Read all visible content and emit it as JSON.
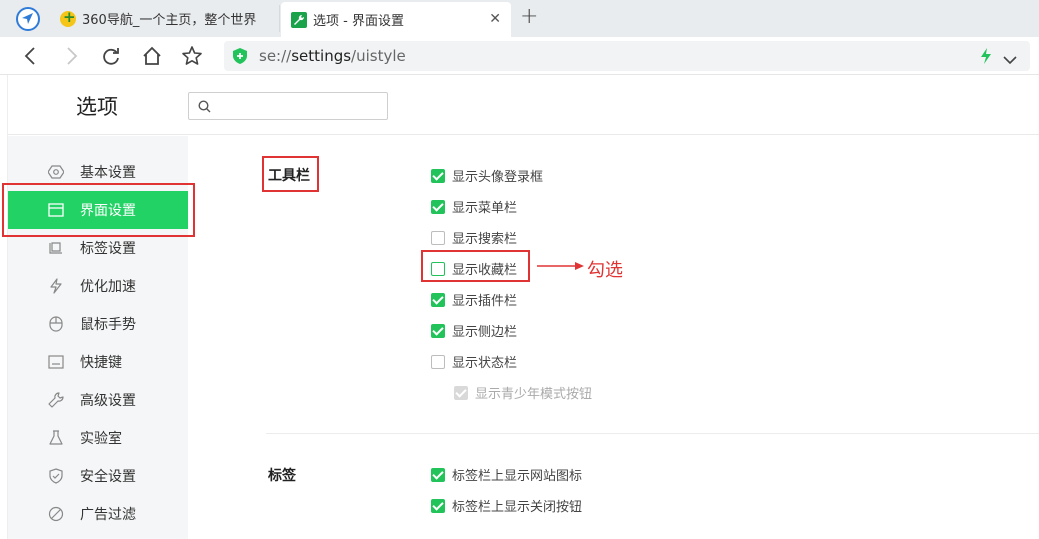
{
  "tabs": [
    {
      "title": "360导航_一个主页，整个世界"
    },
    {
      "title": "选项 - 界面设置"
    }
  ],
  "new_tab_label": "+",
  "close_label": "✕",
  "address": {
    "scheme": "se://",
    "host": "settings",
    "path": "/uistyle"
  },
  "page": {
    "title": "选项",
    "search_placeholder": ""
  },
  "sidebar": {
    "items": [
      {
        "label": "基本设置",
        "icon": "hexagon-icon"
      },
      {
        "label": "界面设置",
        "icon": "window-icon",
        "active": true
      },
      {
        "label": "标签设置",
        "icon": "tab-icon"
      },
      {
        "label": "优化加速",
        "icon": "bolt-icon"
      },
      {
        "label": "鼠标手势",
        "icon": "mouse-icon"
      },
      {
        "label": "快捷键",
        "icon": "keyboard-icon"
      },
      {
        "label": "高级设置",
        "icon": "wrench-icon"
      },
      {
        "label": "实验室",
        "icon": "flask-icon"
      },
      {
        "label": "安全设置",
        "icon": "shield-check-icon"
      },
      {
        "label": "广告过滤",
        "icon": "block-icon"
      }
    ]
  },
  "sections": {
    "toolbar": {
      "label": "工具栏",
      "options": [
        {
          "label": "显示头像登录框",
          "checked": true
        },
        {
          "label": "显示菜单栏",
          "checked": true
        },
        {
          "label": "显示搜索栏",
          "checked": false
        },
        {
          "label": "显示收藏栏",
          "checked": false
        },
        {
          "label": "显示插件栏",
          "checked": true
        },
        {
          "label": "显示侧边栏",
          "checked": true
        },
        {
          "label": "显示状态栏",
          "checked": false
        },
        {
          "label": "显示青少年模式按钮",
          "checked": true,
          "disabled": true
        }
      ]
    },
    "tabs": {
      "label": "标签",
      "options": [
        {
          "label": "标签栏上显示网站图标",
          "checked": true
        },
        {
          "label": "标签栏上显示关闭按钮",
          "checked": true
        }
      ]
    }
  },
  "annotation": "勾选",
  "colors": {
    "accent": "#21c35a",
    "highlight_red": "#e03434"
  }
}
